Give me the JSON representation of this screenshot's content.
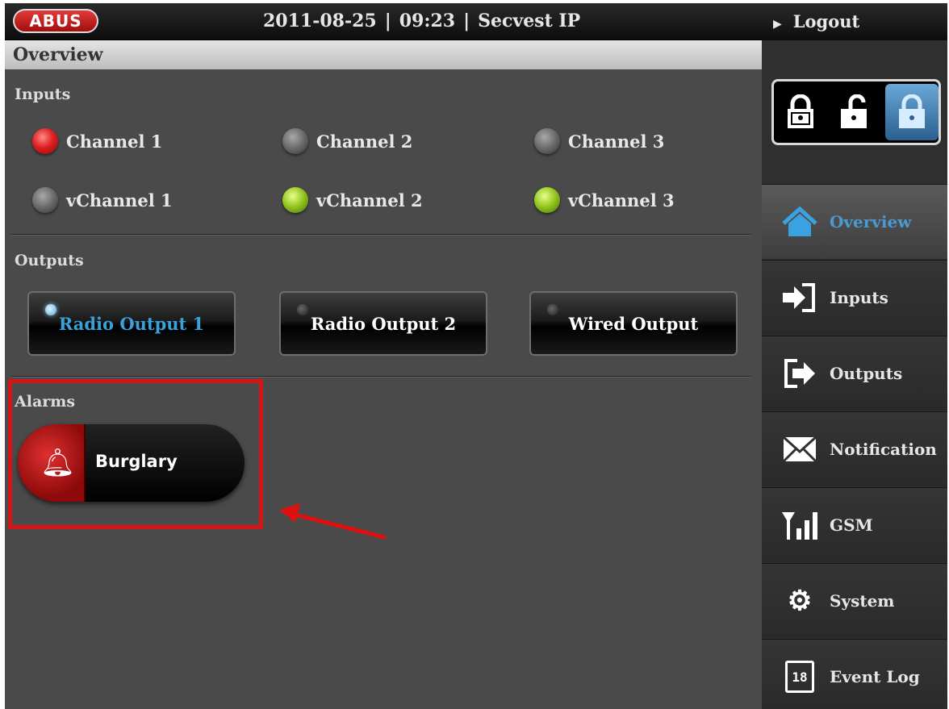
{
  "header": {
    "logo_text": "ABUS",
    "date": "2011-08-25",
    "time": "09:23",
    "device": "Secvest IP",
    "separator": "|"
  },
  "page_title": "Overview",
  "inputs": {
    "label": "Inputs",
    "channels": [
      {
        "label": "Channel 1",
        "state": "red"
      },
      {
        "label": "Channel 2",
        "state": "grey"
      },
      {
        "label": "Channel 3",
        "state": "grey"
      },
      {
        "label": "vChannel 1",
        "state": "grey"
      },
      {
        "label": "vChannel 2",
        "state": "green"
      },
      {
        "label": "vChannel 3",
        "state": "green"
      }
    ]
  },
  "outputs": {
    "label": "Outputs",
    "buttons": [
      {
        "label": "Radio Output 1",
        "active": true
      },
      {
        "label": "Radio Output 2",
        "active": false
      },
      {
        "label": "Wired Output",
        "active": false
      }
    ]
  },
  "alarms": {
    "label": "Alarms",
    "button_label": "Burglary"
  },
  "sidebar": {
    "logout_label": "Logout",
    "lock_states": [
      "armed-icon",
      "unlocked-icon",
      "disarmed-icon"
    ],
    "nav": [
      {
        "label": "Overview",
        "icon": "home-icon",
        "active": true
      },
      {
        "label": "Inputs",
        "icon": "login-icon",
        "active": false
      },
      {
        "label": "Outputs",
        "icon": "logout-icon",
        "active": false
      },
      {
        "label": "Notification",
        "icon": "envelope-icon",
        "active": false
      },
      {
        "label": "GSM",
        "icon": "signal-icon",
        "active": false
      },
      {
        "label": "System",
        "icon": "gear-icon",
        "active": false
      },
      {
        "label": "Event Log",
        "icon": "calendar-icon",
        "active": false
      }
    ],
    "calendar_day": "18"
  },
  "colors": {
    "accent_blue": "#3aa2e0",
    "alarm_red": "#d41515",
    "background": "#4a4a4a"
  }
}
